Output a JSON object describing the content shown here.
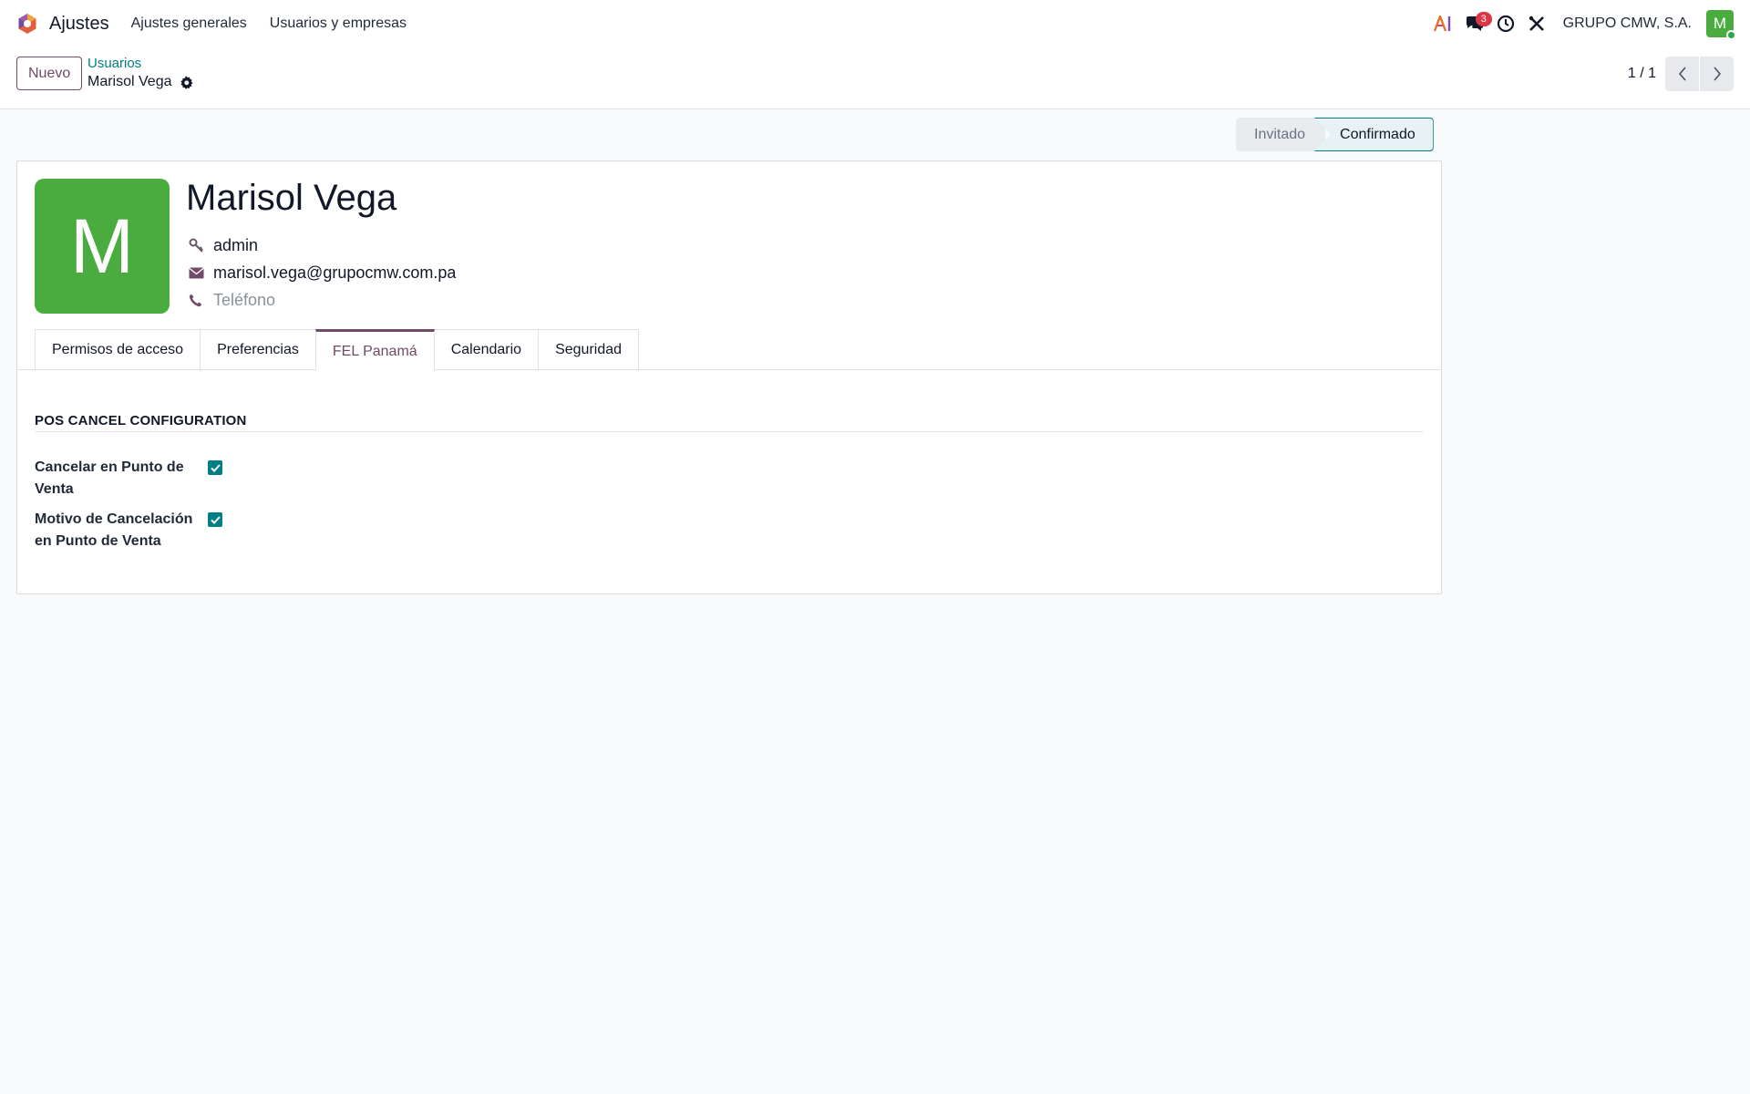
{
  "navbar": {
    "app_name": "Ajustes",
    "menus": [
      "Ajustes generales",
      "Usuarios y empresas"
    ],
    "message_count": "3",
    "company": "GRUPO CMW, S.A.",
    "user_initial": "M",
    "icons": [
      "ai-icon",
      "messages-icon",
      "activity-clock-icon",
      "debug-tools-icon"
    ]
  },
  "control_panel": {
    "new_button": "Nuevo",
    "breadcrumb_parent": "Usuarios",
    "breadcrumb_current": "Marisol Vega",
    "pager": "1 / 1"
  },
  "statusbar": {
    "steps": [
      "Invitado",
      "Confirmado"
    ],
    "active": "Confirmado"
  },
  "record": {
    "avatar_initial": "M",
    "avatar_color": "#4aac3e",
    "name": "Marisol Vega",
    "login": "admin",
    "email": "marisol.vega@grupocmw.com.pa",
    "phone_placeholder": "Teléfono"
  },
  "tabs": [
    "Permisos de acceso",
    "Preferencias",
    "FEL Panamá",
    "Calendario",
    "Seguridad"
  ],
  "active_tab": "FEL Panamá",
  "section": {
    "title": "POS CANCEL CONFIGURATION",
    "settings": [
      {
        "label": "Cancelar en Punto de Venta",
        "checked": true
      },
      {
        "label": "Motivo de Cancelación en Punto de Venta",
        "checked": true
      }
    ]
  },
  "colors": {
    "accent": "#714b67",
    "teal": "#017e84",
    "badge": "#dc3545"
  }
}
